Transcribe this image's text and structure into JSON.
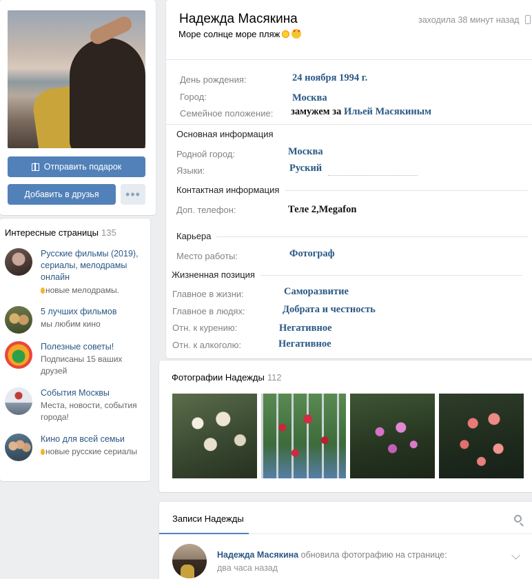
{
  "profile": {
    "name": "Надежда Масякина",
    "status": "Море солнце море пляж",
    "last_seen": "заходила 38 минут назад",
    "icons": {
      "status_emoji_1": "sun-emoji",
      "status_emoji_2": "heart-eyes-emoji",
      "last_seen": "mobile-phone-icon"
    }
  },
  "buttons": {
    "gift": "Отправить подарок",
    "add_friend": "Добавить в друзья",
    "more": "•••"
  },
  "info": {
    "birthday_label": "День рождения:",
    "birthday_value": "24 ноября 1994 г.",
    "city_label": "Город:",
    "city_value": "Москва",
    "family_label": "Семейное положение:",
    "family_prefix": "замужем за",
    "family_spouse": "Ильей Масякиным",
    "basic_section": "Основная информация",
    "hometown_label": "Родной город:",
    "hometown_value": "Москва",
    "languages_label": "Языки:",
    "languages_value": "Руский",
    "contact_section": "Контактная информация",
    "phone_label": "Доп. телефон:",
    "phone_value": "Теле 2,Megafon",
    "career_section": "Карьера",
    "work_label": "Место работы:",
    "work_value": "Фотограф",
    "life_section": "Жизненная позиция",
    "main_life_label": "Главное в жизни:",
    "main_life_value": "Саморазвитие",
    "main_people_label": "Главное в людях:",
    "main_people_value": "Добрата и честность",
    "smoking_label": "Отн. к курению:",
    "smoking_value": "Негативное",
    "alcohol_label": "Отн. к алкоголю:",
    "alcohol_value": "Негативное"
  },
  "interesting": {
    "title": "Интересные страницы",
    "count": "135",
    "items": [
      {
        "title": "Русские фильмы (2019), сериалы, мелодрамы онлайн",
        "subtitle": "новые мелодрамы.",
        "drop": true
      },
      {
        "title": "5 лучших фильмов",
        "subtitle": "мы любим кино",
        "drop": false
      },
      {
        "title": "Полезные советы!",
        "subtitle": "Подписаны 15 ваших друзей",
        "drop": false
      },
      {
        "title": "События Москвы",
        "subtitle": "Места, новости, события города!",
        "drop": false
      },
      {
        "title": "Кино для всей семьи",
        "subtitle": "новые русские сериалы",
        "drop": true
      }
    ]
  },
  "photos": {
    "title": "Фотографии Надежды",
    "count": "112"
  },
  "wall": {
    "tab": "Записи Надежды",
    "post_author": "Надежда Масякина",
    "post_action": "обновила фотографию на странице:",
    "post_time": "два часа назад"
  },
  "colors": {
    "accent": "#5181b8",
    "link": "#2a5885",
    "background": "#edeef0"
  }
}
